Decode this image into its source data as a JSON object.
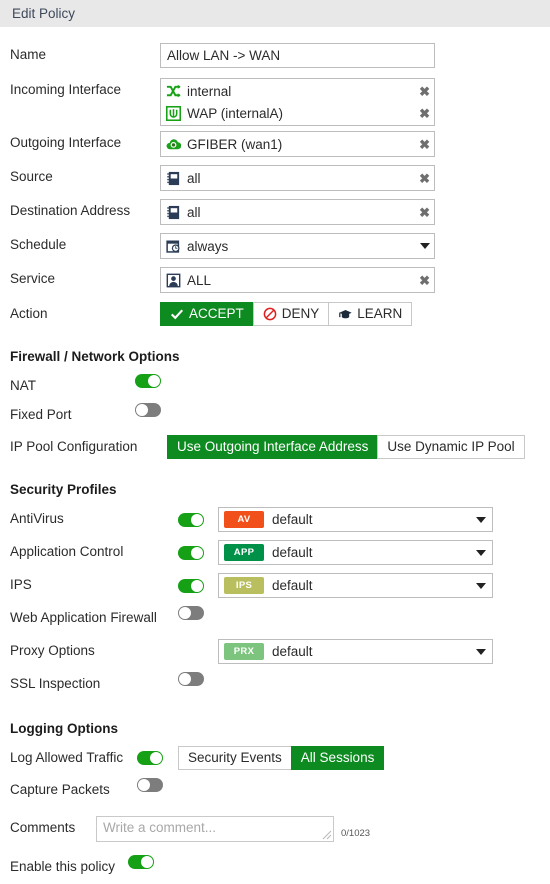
{
  "window": {
    "title": "Edit Policy"
  },
  "form": {
    "name": {
      "label": "Name",
      "value": "Allow LAN -> WAN"
    },
    "incoming_interface": {
      "label": "Incoming Interface",
      "items": [
        {
          "text": "internal",
          "icon": "shuffle-interface-icon",
          "remove": "✖"
        },
        {
          "text": "WAP (internalA)",
          "icon": "wifi-ap-icon",
          "remove": "✖"
        }
      ]
    },
    "outgoing_interface": {
      "label": "Outgoing Interface",
      "items": [
        {
          "text": "GFIBER (wan1)",
          "icon": "sdwan-cloud-icon",
          "remove": "✖"
        }
      ]
    },
    "source": {
      "label": "Source",
      "items": [
        {
          "text": "all",
          "icon": "address-book-icon",
          "remove": "✖"
        }
      ]
    },
    "destination_address": {
      "label": "Destination Address",
      "items": [
        {
          "text": "all",
          "icon": "address-book-icon",
          "remove": "✖"
        }
      ]
    },
    "schedule": {
      "label": "Schedule",
      "value": "always",
      "icon": "calendar-clock-icon"
    },
    "service": {
      "label": "Service",
      "items": [
        {
          "text": "ALL",
          "icon": "service-user-icon",
          "remove": "✖"
        }
      ]
    },
    "action": {
      "label": "Action",
      "options": [
        {
          "label": "ACCEPT",
          "icon": "check-icon",
          "selected": true
        },
        {
          "label": "DENY",
          "icon": "deny-circle-icon",
          "selected": false
        },
        {
          "label": "LEARN",
          "icon": "graduation-cap-icon",
          "selected": false
        }
      ]
    }
  },
  "firewall_network_options": {
    "heading": "Firewall / Network Options",
    "nat": {
      "label": "NAT",
      "enabled": true
    },
    "fixed_port": {
      "label": "Fixed Port",
      "enabled": false
    },
    "ip_pool_configuration": {
      "label": "IP Pool Configuration",
      "options": [
        {
          "label": "Use Outgoing Interface Address",
          "selected": true
        },
        {
          "label": "Use Dynamic IP Pool",
          "selected": false
        }
      ]
    }
  },
  "security_profiles": {
    "heading": "Security Profiles",
    "rows": [
      {
        "label": "AntiVirus",
        "enabled": true,
        "has_select": true,
        "badge": "AV",
        "badge_color": "#f2501a",
        "value": "default"
      },
      {
        "label": "Application Control",
        "enabled": true,
        "has_select": true,
        "badge": "APP",
        "badge_color": "#009149",
        "value": "default"
      },
      {
        "label": "IPS",
        "enabled": true,
        "has_select": true,
        "badge": "IPS",
        "badge_color": "#b9bf5e",
        "value": "default"
      },
      {
        "label": "Web Application Firewall",
        "enabled": false,
        "has_select": false
      },
      {
        "label": "Proxy Options",
        "enabled": null,
        "has_select": true,
        "badge": "PRX",
        "badge_color": "#7dc47f",
        "value": "default"
      },
      {
        "label": "SSL Inspection",
        "enabled": false,
        "has_select": false
      }
    ]
  },
  "logging_options": {
    "heading": "Logging Options",
    "log_allowed_traffic": {
      "label": "Log Allowed Traffic",
      "enabled": true,
      "options": [
        {
          "label": "Security Events",
          "selected": false
        },
        {
          "label": "All Sessions",
          "selected": true
        }
      ]
    },
    "capture_packets": {
      "label": "Capture Packets",
      "enabled": false
    },
    "comments": {
      "label": "Comments",
      "placeholder": "Write a comment...",
      "value": "",
      "counter": "0/1023"
    },
    "enable_policy": {
      "label": "Enable this policy",
      "enabled": true
    }
  },
  "colors": {
    "accent_green": "#0e8b20",
    "toggle_on": "#16a015",
    "toggle_off": "#7d7d7d",
    "header_bg": "#e8e8e8",
    "title_text": "#3d4a5c"
  }
}
